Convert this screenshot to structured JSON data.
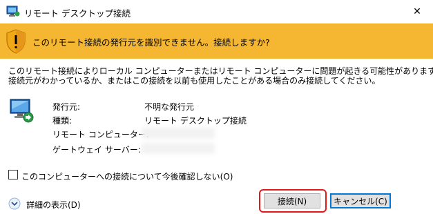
{
  "window": {
    "title": "リモート デスクトップ接続",
    "close_glyph": "✕"
  },
  "banner": {
    "message": "このリモート接続の発行元を識別できません。接続しますか?",
    "color": "#f5b731"
  },
  "description": {
    "line1": "このリモート接続によりローカル コンピューターまたはリモート コンピューターに問題が起きる可能性があります。",
    "line2": "接続元がわかっているか、またはこの接続を以前も使用したことがある場合のみ接続してください。"
  },
  "info": {
    "publisher_label": "発行元:",
    "publisher_value": "不明な発行元",
    "type_label": "種類:",
    "type_value": "リモート デスクトップ接続",
    "remote_computer_label": "リモート コンピューター:",
    "gateway_label": "ゲートウェイ サーバー:"
  },
  "dont_ask": {
    "label": "このコンピューターへの接続について今後確認しない(O)",
    "checked": false
  },
  "details": {
    "label": "詳細の表示(D)"
  },
  "buttons": {
    "connect": "接続(N)",
    "cancel": "キャンセル(C)"
  },
  "colors": {
    "highlight": "#e01919",
    "focus": "#0078d7"
  }
}
